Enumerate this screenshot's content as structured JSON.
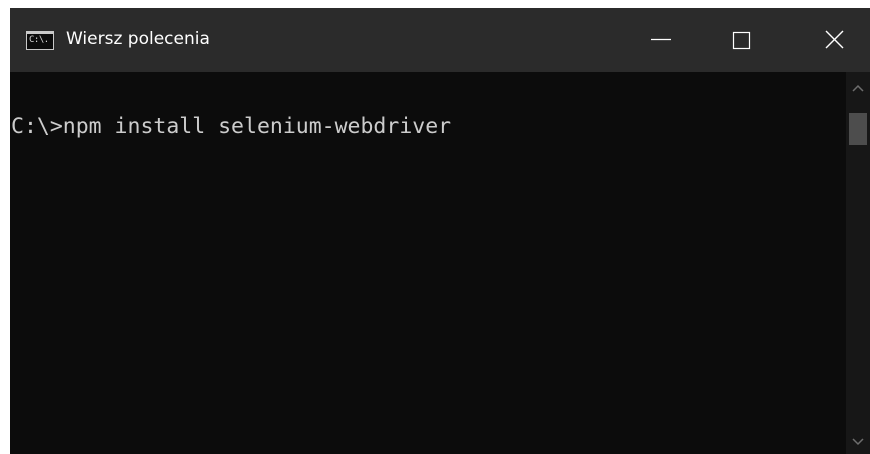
{
  "window": {
    "title": "Wiersz polecenia",
    "icon": "cmd-app-icon",
    "icon_glyph": "C:\\."
  },
  "titlebar_buttons": {
    "minimize": "minimize-icon",
    "maximize": "maximize-icon",
    "close": "close-icon"
  },
  "console": {
    "lines": [
      "C:\\>npm install selenium-webdriver"
    ],
    "text_color": "#cccccc",
    "background": "#0c0c0c"
  },
  "scrollbar": {
    "up": "chevron-up-icon",
    "down": "chevron-down-icon"
  },
  "colors": {
    "titlebar": "#2b2b2b",
    "title_text": "#ffffff"
  }
}
